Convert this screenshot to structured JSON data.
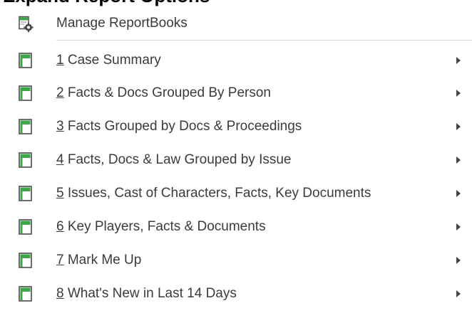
{
  "header": {
    "title": "Expand Report Options"
  },
  "menu": {
    "manage": {
      "label": "Manage ReportBooks",
      "icon": "reportbook-settings-icon"
    },
    "items": [
      {
        "mnemonic": "1",
        "label": " Case Summary",
        "icon": "reportbook-icon",
        "submenu_icon": "chevron-right-icon"
      },
      {
        "mnemonic": "2",
        "label": " Facts & Docs Grouped By Person",
        "icon": "reportbook-icon",
        "submenu_icon": "chevron-right-icon"
      },
      {
        "mnemonic": "3",
        "label": " Facts Grouped by Docs & Proceedings",
        "icon": "reportbook-icon",
        "submenu_icon": "chevron-right-icon"
      },
      {
        "mnemonic": "4",
        "label": " Facts, Docs & Law Grouped by Issue",
        "icon": "reportbook-icon",
        "submenu_icon": "chevron-right-icon"
      },
      {
        "mnemonic": "5",
        "label": " Issues, Cast of Characters, Facts, Key Documents",
        "icon": "reportbook-icon",
        "submenu_icon": "chevron-right-icon"
      },
      {
        "mnemonic": "6",
        "label": " Key Players, Facts & Documents",
        "icon": "reportbook-icon",
        "submenu_icon": "chevron-right-icon"
      },
      {
        "mnemonic": "7",
        "label": " Mark Me Up",
        "icon": "reportbook-icon",
        "submenu_icon": "chevron-right-icon"
      },
      {
        "mnemonic": "8",
        "label": " What's New in Last 14 Days",
        "icon": "reportbook-icon",
        "submenu_icon": "chevron-right-icon"
      }
    ]
  },
  "colors": {
    "icon_green": "#3da648",
    "icon_border": "#4a4a4a",
    "text": "#3b3b3b",
    "separator": "#d9d9d9"
  }
}
